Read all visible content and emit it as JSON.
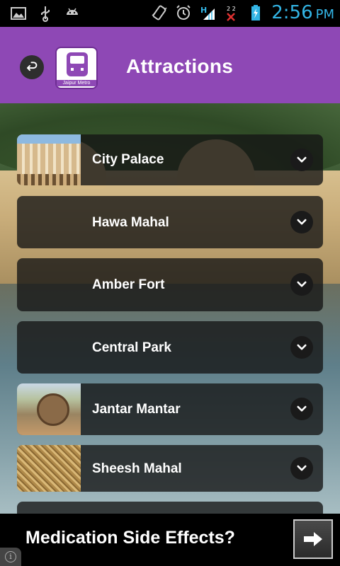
{
  "status_bar": {
    "time": "2:56",
    "ampm": "PM",
    "icons": [
      "image-icon",
      "usb-icon",
      "android-icon",
      "vibrate-icon",
      "alarm-icon",
      "network-h-icon",
      "signal-x-icon",
      "battery-charging-icon"
    ],
    "clock_color": "#33b5e5"
  },
  "header": {
    "title": "Attractions",
    "logo_label": "Jaipur Metro",
    "background": "#8e48b5"
  },
  "attractions": [
    {
      "name": "City Palace",
      "has_thumbnail": true,
      "thumbnail": "city-palace"
    },
    {
      "name": "Hawa Mahal",
      "has_thumbnail": false
    },
    {
      "name": "Amber Fort",
      "has_thumbnail": false
    },
    {
      "name": "Central Park",
      "has_thumbnail": false
    },
    {
      "name": "Jantar Mantar",
      "has_thumbnail": true,
      "thumbnail": "jantar-mantar"
    },
    {
      "name": "Sheesh Mahal",
      "has_thumbnail": true,
      "thumbnail": "sheesh-mahal"
    }
  ],
  "ad": {
    "text": "Medication Side Effects?",
    "info_glyph": "i"
  }
}
